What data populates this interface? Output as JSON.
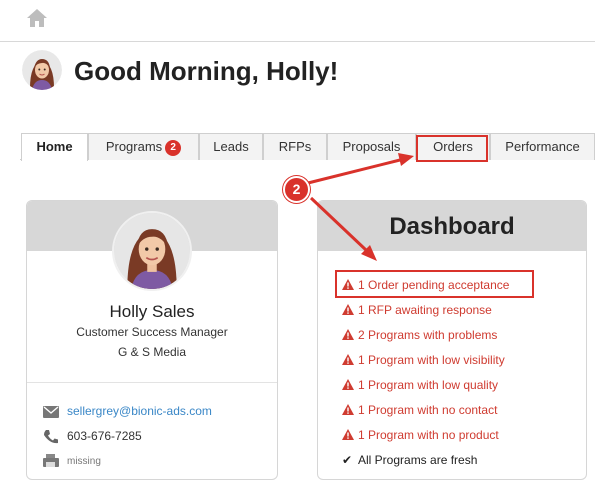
{
  "header": {
    "home_icon": "home-icon"
  },
  "greeting": "Good Morning, Holly!",
  "tabs": [
    {
      "label": "Home",
      "active": true
    },
    {
      "label": "Programs",
      "badge": "2"
    },
    {
      "label": "Leads"
    },
    {
      "label": "RFPs"
    },
    {
      "label": "Proposals"
    },
    {
      "label": "Orders"
    },
    {
      "label": "Performance"
    }
  ],
  "profile": {
    "name": "Holly Sales",
    "role": "Customer Success Manager",
    "company": "G & S Media",
    "email": "sellergrey@bionic-ads.com",
    "phone": "603-676-7285",
    "fax": "missing"
  },
  "dashboard": {
    "title": "Dashboard",
    "alerts": [
      "1 Order pending acceptance",
      "1 RFP awaiting response",
      "2 Programs with problems",
      "1 Program with low visibility",
      "1 Program with low quality",
      "1 Program with no contact",
      "1 Program with no product"
    ],
    "ok": "All Programs are fresh"
  },
  "annotation": {
    "step": "2"
  },
  "colors": {
    "alert": "#cf3b30",
    "highlight": "#d9322b",
    "link": "#3a87c7",
    "card_header": "#d7d7d7"
  }
}
